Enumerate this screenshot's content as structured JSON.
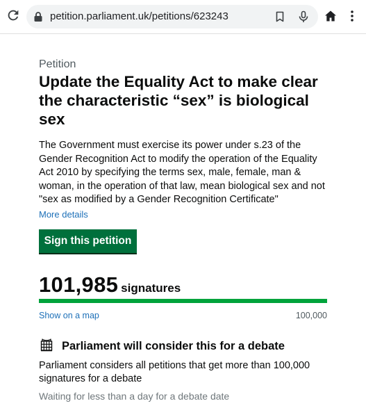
{
  "browser": {
    "url": "petition.parliament.uk/petitions/623243"
  },
  "petition": {
    "kicker": "Petition",
    "title": "Update the Equality Act to make clear the characteristic “sex” is biological sex",
    "description": "The Government must exercise its power under s.23 of the Gender Recognition Act to modify the operation of the Equality Act 2010 by specifying the terms sex, male, female, man & woman, in the operation of that law, mean biological sex and not \"sex as modified by a Gender Recognition Certificate\"",
    "more_details": "More details",
    "sign_button": "Sign this petition"
  },
  "signatures": {
    "count": "101,985",
    "label": "signatures",
    "show_map": "Show on a map",
    "threshold": "100,000",
    "progress_fraction": 1.0
  },
  "debate": {
    "heading": "Parliament will consider this for a debate",
    "text": "Parliament considers all petitions that get more than 100,000 signatures for a debate",
    "waiting": "Waiting for less than a day for a debate date"
  },
  "colors": {
    "accent_green": "#00703c",
    "progress_green": "#00a33b",
    "link_blue": "#1d70b8"
  }
}
